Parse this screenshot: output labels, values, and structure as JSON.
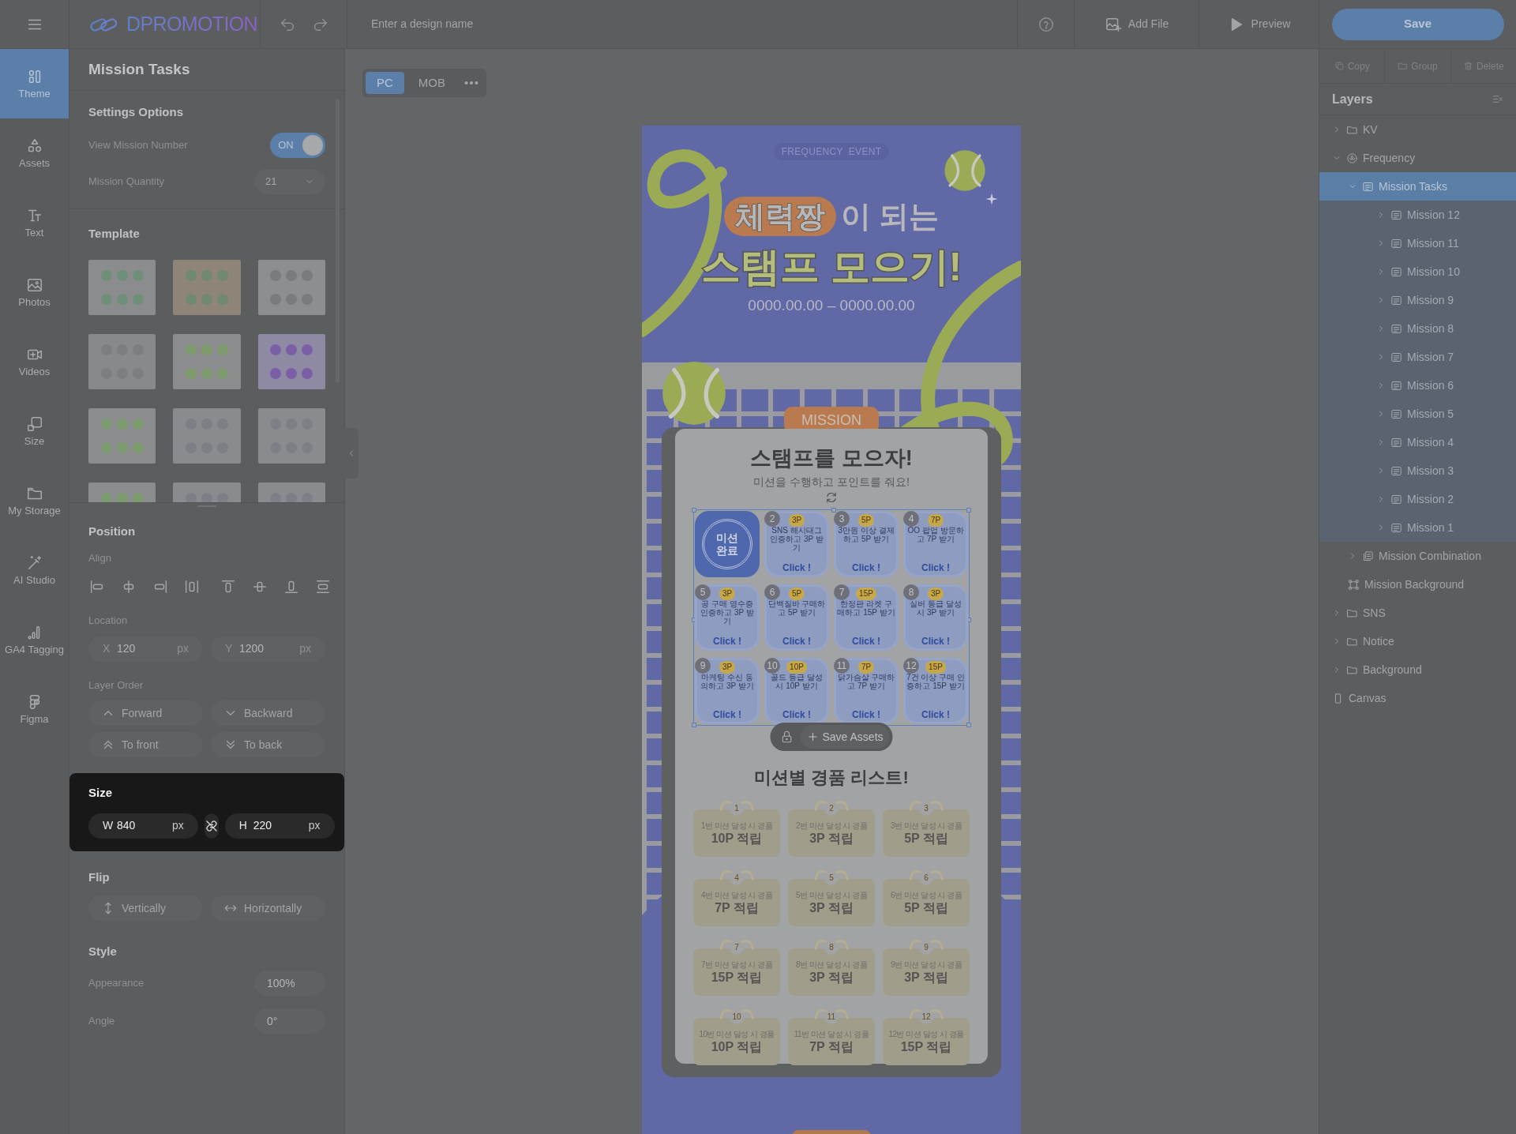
{
  "app": {
    "logo": "DPROMOTION",
    "design_name": {
      "placeholder": "Enter a design name"
    },
    "actions": [
      {
        "label": "Add File",
        "kind": "add-file"
      },
      {
        "label": "Preview",
        "kind": "preview"
      }
    ],
    "save": "Save"
  },
  "rail": [
    {
      "label": "Theme",
      "kind": "theme",
      "selected": true
    },
    {
      "label": "Assets",
      "kind": "assets",
      "selected": false
    },
    {
      "label": "Text",
      "kind": "text",
      "selected": false
    },
    {
      "label": "Photos",
      "kind": "photos",
      "selected": false
    },
    {
      "label": "Videos",
      "kind": "videos",
      "selected": false
    },
    {
      "label": "Size",
      "kind": "size",
      "selected": false
    },
    {
      "label": "My Storage",
      "kind": "storage",
      "selected": false
    },
    {
      "label": "AI Studio",
      "kind": "ai",
      "selected": false
    },
    {
      "label": "GA4 Tagging",
      "kind": "analytics",
      "selected": false
    },
    {
      "label": "Figma",
      "kind": "figma",
      "selected": false
    }
  ],
  "panel": {
    "title": "Mission Tasks",
    "settings": {
      "heading": "Settings Options",
      "toggle": {
        "label": "View Mission Number",
        "on": true,
        "text": "ON"
      },
      "quantity": {
        "label": "Mission Quantity",
        "value": "21"
      }
    },
    "template": {
      "heading": "Template"
    },
    "position": {
      "heading": "Position",
      "align_label": "Align",
      "location_label": "Location",
      "x": {
        "axis": "X",
        "value": "120",
        "unit": "px"
      },
      "y": {
        "axis": "Y",
        "value": "1200",
        "unit": "px"
      },
      "order_label": "Layer Order",
      "order_buttons": [
        {
          "label": "Forward",
          "kind": "up"
        },
        {
          "label": "Backward",
          "kind": "down"
        },
        {
          "label": "To front",
          "kind": "top"
        },
        {
          "label": "To back",
          "kind": "bottom"
        }
      ]
    },
    "size": {
      "heading": "Size",
      "w": {
        "axis": "W",
        "value": "840",
        "unit": "px"
      },
      "h": {
        "axis": "H",
        "value": "220",
        "unit": "px"
      }
    },
    "flip": {
      "heading": "Flip",
      "buttons": [
        {
          "label": "Vertically",
          "kind": "vertical"
        },
        {
          "label": "Horizontally",
          "kind": "horizontal"
        }
      ]
    },
    "style": {
      "heading": "Style",
      "rows": [
        {
          "label": "Appearance",
          "value": "100%"
        },
        {
          "label": "Angle",
          "value": "0°"
        }
      ]
    }
  },
  "canvas": {
    "device_tabs": [
      {
        "label": "PC",
        "selected": true
      },
      {
        "label": "MOB",
        "selected": false
      }
    ]
  },
  "artboard": {
    "badge": "FREQUENCY  EVENT",
    "title_highlight": "체력짱",
    "title_rest": "이 되는",
    "title_line2": "스탬프 모으기!",
    "dates": "0000.00.00 – 0000.00.00",
    "mission_tag": "MISSION",
    "heading": "스탬프를 모으자!",
    "subheading": "미션을 수행하고 포인트를 줘요!",
    "missions": [
      {
        "kind": "done",
        "stamp": "미션 완료"
      },
      {
        "kind": "todo",
        "number": "2",
        "points": "3P",
        "text": "SNS 해시태그 인증하고 3P 받기",
        "cta": "Click !"
      },
      {
        "kind": "todo",
        "number": "3",
        "points": "5P",
        "text": "3만원 이상 결제하고 5P 받기",
        "cta": "Click !"
      },
      {
        "kind": "todo",
        "number": "4",
        "points": "7P",
        "text": "OO 팝업 방문하고 7P 받기",
        "cta": "Click !"
      },
      {
        "kind": "todo",
        "number": "5",
        "points": "3P",
        "text": "공 구매 영수증 인증하고 3P 받기",
        "cta": "Click !"
      },
      {
        "kind": "todo",
        "number": "6",
        "points": "5P",
        "text": "단백질바 구매하고 5P 받기",
        "cta": "Click !"
      },
      {
        "kind": "todo",
        "number": "7",
        "points": "15P",
        "text": "한정판 라켓 구매하고 15P 받기",
        "cta": "Click !"
      },
      {
        "kind": "todo",
        "number": "8",
        "points": "3P",
        "text": "실버 등급 달성 시 3P 받기",
        "cta": "Click !"
      },
      {
        "kind": "todo",
        "number": "9",
        "points": "3P",
        "text": "마케팅 수신 동의하고 3P 받기",
        "cta": "Click !"
      },
      {
        "kind": "todo",
        "number": "10",
        "points": "10P",
        "text": "골드 등급 달성 시 10P 받기",
        "cta": "Click !"
      },
      {
        "kind": "todo",
        "number": "11",
        "points": "7P",
        "text": "닭가슴살 구매하고 7P 받기",
        "cta": "Click !"
      },
      {
        "kind": "todo",
        "number": "12",
        "points": "15P",
        "text": "7건 이상 구매 인증하고 15P 받기",
        "cta": "Click !"
      }
    ],
    "toolbar": {
      "button": "Save Assets"
    },
    "prize_heading": "미션별 경품 리스트!",
    "prizes": [
      {
        "number": "1",
        "caption": "1번 미션 달성 시 경품",
        "value": "10P 적립"
      },
      {
        "number": "2",
        "caption": "2번 미션 달성 시 경품",
        "value": "3P 적립"
      },
      {
        "number": "3",
        "caption": "3번 미션 달성 시 경품",
        "value": "5P 적립"
      },
      {
        "number": "4",
        "caption": "4번 미션 달성 시 경품",
        "value": "7P 적립"
      },
      {
        "number": "5",
        "caption": "5번 미션 달성 시 경품",
        "value": "3P 적립"
      },
      {
        "number": "6",
        "caption": "6번 미션 달성 시 경품",
        "value": "5P 적립"
      },
      {
        "number": "7",
        "caption": "7번 미션 달성 시 경품",
        "value": "15P 적립"
      },
      {
        "number": "8",
        "caption": "8번 미션 달성 시 경품",
        "value": "3P 적립"
      },
      {
        "number": "9",
        "caption": "9번 미션 달성 시 경품",
        "value": "3P 적립"
      },
      {
        "number": "10",
        "caption": "10번 미션 달성 시 경품",
        "value": "10P 적립"
      },
      {
        "number": "11",
        "caption": "11번 미션 달성 시 경품",
        "value": "7P 적립"
      },
      {
        "number": "12",
        "caption": "12번 미션 달성 시 경품",
        "value": "15P 적립"
      }
    ]
  },
  "layers": {
    "actions": [
      {
        "label": "Copy",
        "kind": "copy"
      },
      {
        "label": "Group",
        "kind": "group"
      },
      {
        "label": "Delete",
        "kind": "delete"
      }
    ],
    "title": "Layers",
    "tree": [
      {
        "label": "KV",
        "kind": "folder",
        "expanded": false,
        "selected": false
      },
      {
        "label": "Frequency",
        "kind": "component",
        "expanded": true,
        "selected": false,
        "children": [
          {
            "label": "Mission Tasks",
            "kind": "list",
            "expanded": true,
            "selected": true,
            "children": [
              {
                "label": "Mission 12",
                "kind": "list",
                "expanded": false,
                "selected": false
              },
              {
                "label": "Mission 11",
                "kind": "list",
                "expanded": false,
                "selected": false
              },
              {
                "label": "Mission 10",
                "kind": "list",
                "expanded": false,
                "selected": false
              },
              {
                "label": "Mission 9",
                "kind": "list",
                "expanded": false,
                "selected": false
              },
              {
                "label": "Mission 8",
                "kind": "list",
                "expanded": false,
                "selected": false
              },
              {
                "label": "Mission 7",
                "kind": "list",
                "expanded": false,
                "selected": false
              },
              {
                "label": "Mission 6",
                "kind": "list",
                "expanded": false,
                "selected": false
              },
              {
                "label": "Mission 5",
                "kind": "list",
                "expanded": false,
                "selected": false
              },
              {
                "label": "Mission 4",
                "kind": "list",
                "expanded": false,
                "selected": false
              },
              {
                "label": "Mission 3",
                "kind": "list",
                "expanded": false,
                "selected": false
              },
              {
                "label": "Mission 2",
                "kind": "list",
                "expanded": false,
                "selected": false
              },
              {
                "label": "Mission 1",
                "kind": "list",
                "expanded": false,
                "selected": false
              }
            ]
          },
          {
            "label": "Mission Combination",
            "kind": "stack",
            "expanded": false,
            "selected": false
          },
          {
            "label": "Mission Background",
            "kind": "frame",
            "selected": false
          }
        ]
      },
      {
        "label": "SNS",
        "kind": "folder",
        "expanded": false,
        "selected": false
      },
      {
        "label": "Notice",
        "kind": "folder",
        "expanded": false,
        "selected": false
      },
      {
        "label": "Background",
        "kind": "folder",
        "expanded": false,
        "selected": false
      },
      {
        "label": "Canvas",
        "kind": "canvas",
        "selected": false
      }
    ]
  }
}
